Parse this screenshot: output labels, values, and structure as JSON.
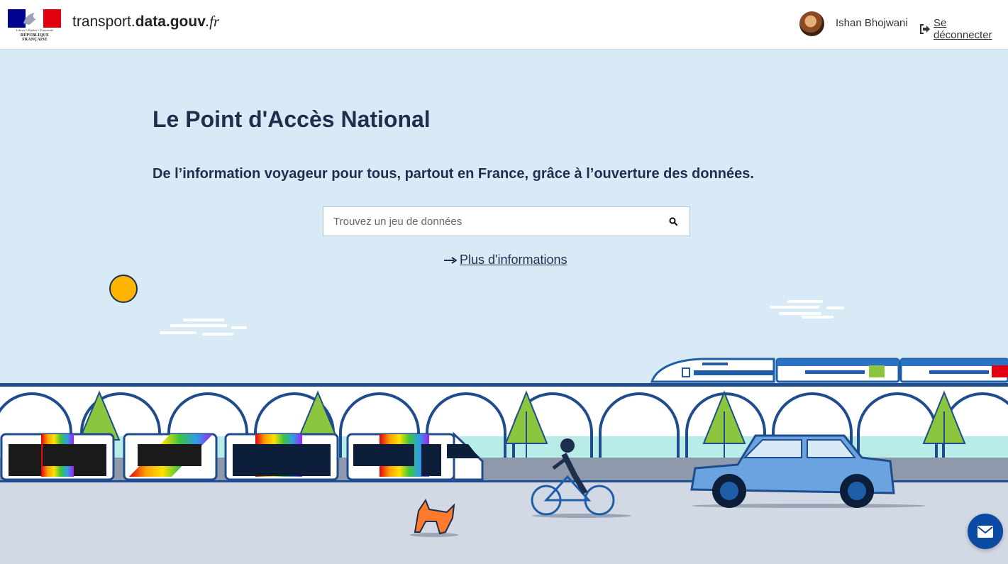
{
  "header": {
    "logo_motto": "Liberté • Égalité • Fraternité",
    "logo_name": "RÉPUBLIQUE FRANÇAISE",
    "brand": {
      "part1": "transport.",
      "part2": "data.gouv",
      "part3": ".fr"
    },
    "user_name": "Ishan Bhojwani",
    "logout_label": "Se déconnecter"
  },
  "hero": {
    "title": "Le Point d'Accès National",
    "subtitle": "De l’information voyageur pour tous, partout en France, grâce à l’ouverture des données.",
    "search_placeholder": "Trouvez un jeu de données",
    "more_label": "Plus d'informations"
  },
  "colors": {
    "sky": "#d9eaf7",
    "navy": "#1e2f4d",
    "accent_blue": "#0b4aa2",
    "sun": "#ffb400",
    "tree": "#8cc63f"
  },
  "icons": {
    "search": "search-icon",
    "logout": "sign-out-icon",
    "arrow": "arrow-right-icon",
    "contact": "envelope-icon"
  }
}
